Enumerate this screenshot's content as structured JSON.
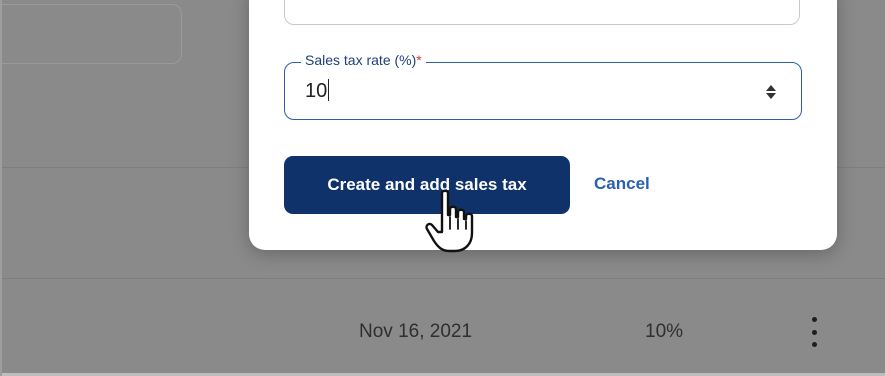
{
  "background": {
    "row": {
      "date": "Nov 16, 2021",
      "rate": "10%"
    },
    "icons": {
      "more": "kebab-menu-icon"
    }
  },
  "modal": {
    "rate_field": {
      "label": "Sales tax rate (%)",
      "required_marker": "*",
      "value": "10",
      "icon": "number-spinner-icon"
    },
    "primary_button": "Create and add sales tax",
    "cancel_link": "Cancel"
  },
  "colors": {
    "primary": "#10326b",
    "link": "#2d5fb0",
    "focus_border": "#2f5da8",
    "required": "#d43a3a",
    "overlay": "#8a8a8a"
  },
  "cursor": "hand-pointer-icon"
}
